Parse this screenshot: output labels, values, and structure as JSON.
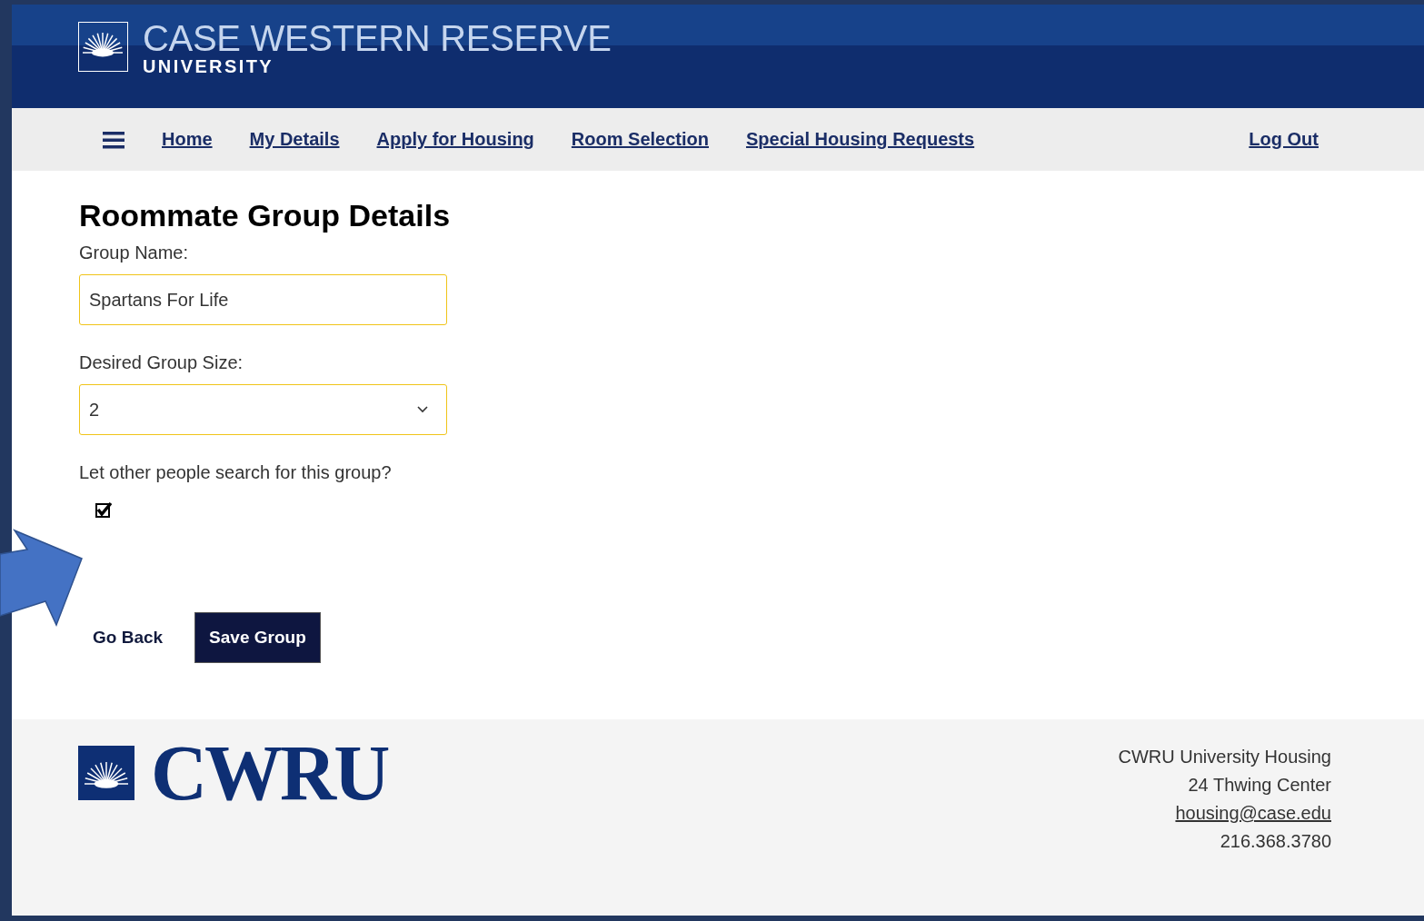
{
  "header": {
    "logo_title": "CASE WESTERN RESERVE",
    "logo_subtitle": "UNIVERSITY"
  },
  "nav": {
    "links": [
      {
        "label": "Home"
      },
      {
        "label": "My Details"
      },
      {
        "label": "Apply for Housing"
      },
      {
        "label": "Room Selection"
      },
      {
        "label": "Special Housing Requests"
      }
    ],
    "logout": "Log Out"
  },
  "form": {
    "title": "Roommate Group Details",
    "fields": [
      {
        "kind": "text",
        "label": "Group Name:",
        "value": "Spartans For Life"
      },
      {
        "kind": "select",
        "label": "Desired Group Size:",
        "value": "2"
      },
      {
        "kind": "checkbox",
        "label": "Let other people search for this group?",
        "checked": true
      }
    ]
  },
  "buttons": [
    {
      "kind": "link",
      "label": "Go Back"
    },
    {
      "kind": "primary",
      "label": "Save Group"
    }
  ],
  "footer": {
    "logo_text": "CWRU",
    "lines": [
      {
        "kind": "text",
        "text": "CWRU University Housing"
      },
      {
        "kind": "text",
        "text": "24 Thwing Center"
      },
      {
        "kind": "link",
        "text": "housing@case.edu"
      },
      {
        "kind": "text",
        "text": "216.368.3780"
      }
    ]
  }
}
